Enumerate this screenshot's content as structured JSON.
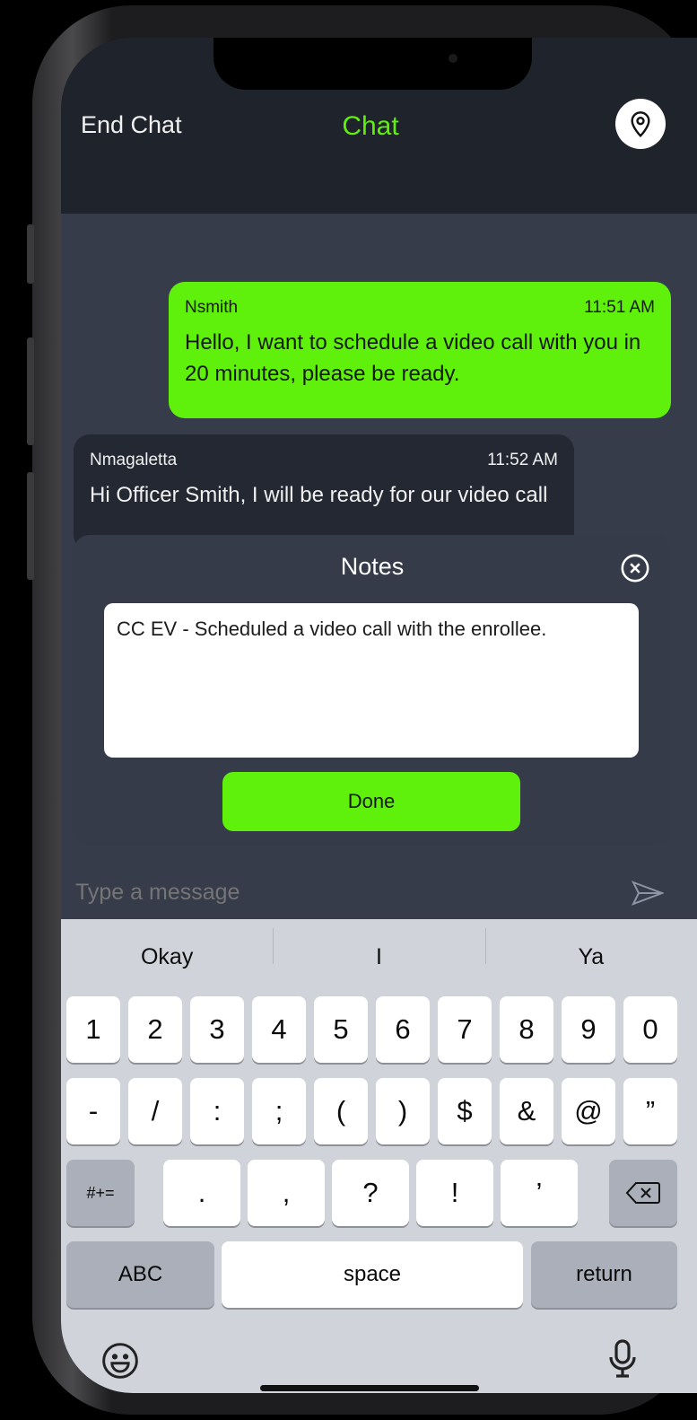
{
  "header": {
    "end_chat": "End Chat",
    "title": "Chat",
    "location_icon": "location-pin-icon"
  },
  "messages": [
    {
      "sender": "Nsmith",
      "time": "11:51 AM",
      "text": "Hello, I want to schedule a video call with you in 20 minutes, please be ready.",
      "direction": "outgoing"
    },
    {
      "sender": "Nmagaletta",
      "time": "11:52 AM",
      "text": "Hi Officer Smith, I will be ready for our video call",
      "direction": "incoming"
    }
  ],
  "notes": {
    "title": "Notes",
    "value": "CC EV - Scheduled a video call with the enrollee.",
    "done_label": "Done"
  },
  "composer": {
    "placeholder": "Type a message"
  },
  "keyboard": {
    "suggestions": [
      "Okay",
      "I",
      "Ya"
    ],
    "row1": [
      "1",
      "2",
      "3",
      "4",
      "5",
      "6",
      "7",
      "8",
      "9",
      "0"
    ],
    "row2": [
      "-",
      "/",
      ":",
      ";",
      "(",
      ")",
      "$",
      "&",
      "@",
      "”"
    ],
    "row3_symbols": "#+=",
    "row3": [
      ".",
      ",",
      "?",
      "!",
      "’"
    ],
    "abc": "ABC",
    "space": "space",
    "return": "return"
  },
  "colors": {
    "accent": "#5ff00b",
    "background": "#363c4a",
    "header": "#1f232b",
    "keyboard": "#d0d3da"
  }
}
